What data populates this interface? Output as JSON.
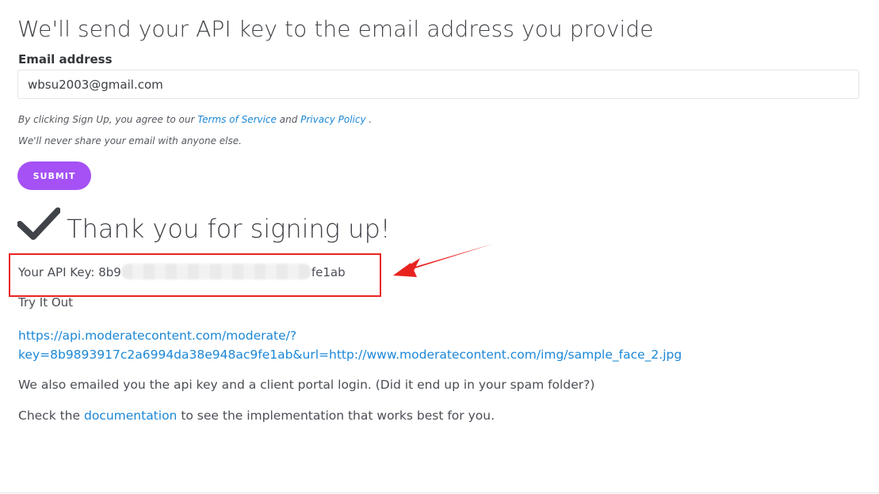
{
  "form": {
    "heading": "We'll send your API key to the email address you provide",
    "email_label": "Email address",
    "email_value": "wbsu2003@gmail.com",
    "consent_prefix": "By clicking Sign Up, you agree to our ",
    "terms_label": "Terms of Service",
    "consent_and": " and ",
    "privacy_label": "Privacy Policy",
    "consent_suffix": " .",
    "privacy_note": "We'll never share your email with anyone else.",
    "submit_label": "SUBMIT",
    "submit_color": "#a551f5"
  },
  "result": {
    "check_icon": "checkmark-icon",
    "heading": "Thank you for signing up!",
    "api_key_prefix": "Your API Key: 8b9",
    "api_key_suffix": "fe1ab",
    "try_label": "Try It Out",
    "sample_link_line1": "https://api.moderatecontent.com/moderate/?",
    "sample_link_line2": "key=8b9893917c2a6994da38e948ac9fe1ab&url=http://www.moderatecontent.com/img/sample_face_2.jpg",
    "emailed_text": "We also emailed you the api key and a client portal login. (Did it end up in your spam folder?)",
    "docs_prefix": "Check the ",
    "docs_link": "documentation",
    "docs_suffix": " to see the implementation that works best for you."
  },
  "annotation": {
    "color": "#e8231f",
    "arrow_icon": "red-arrow-icon"
  },
  "colors": {
    "link": "#1b87d6",
    "text": "#4a4e54"
  }
}
